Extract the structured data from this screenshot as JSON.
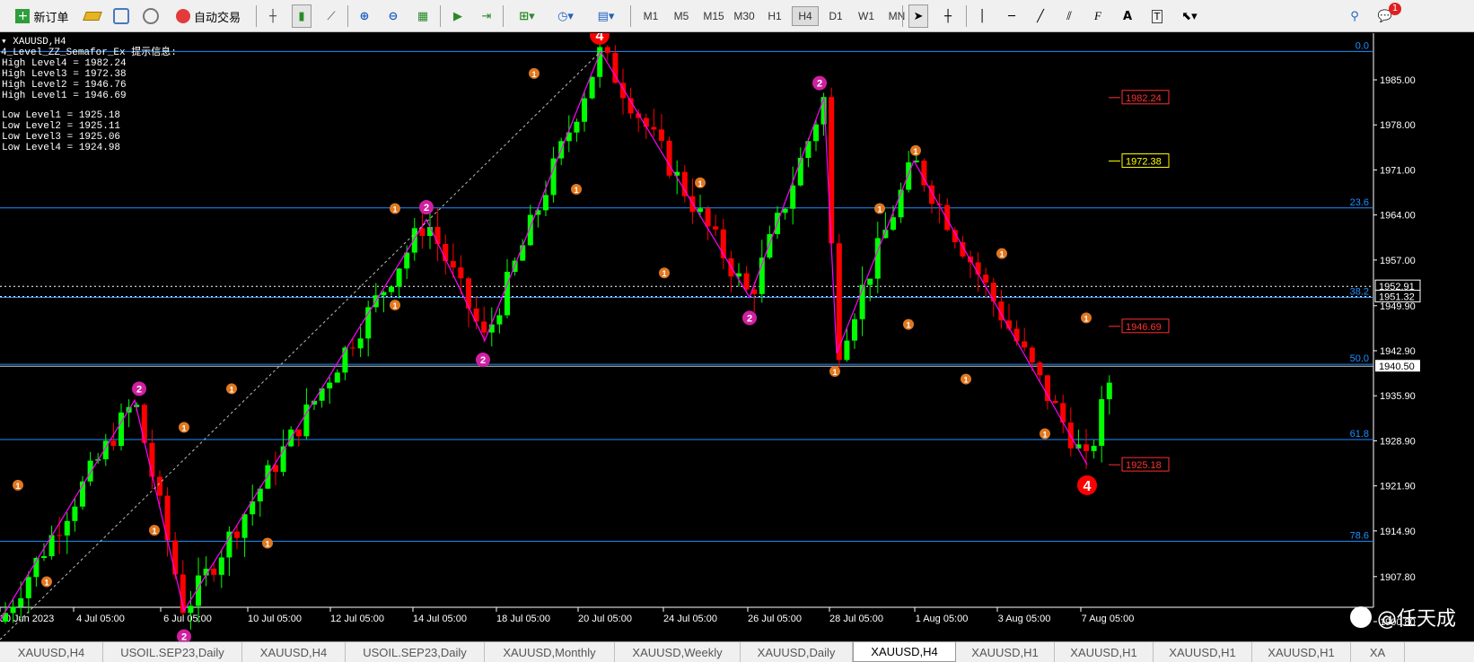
{
  "toolbar": {
    "new_order_label": "新订单",
    "autotrade_label": "自动交易",
    "timeframes": [
      "M1",
      "M5",
      "M15",
      "M30",
      "H1",
      "H4",
      "D1",
      "W1",
      "MN"
    ],
    "active_timeframe": "H4",
    "notification_count": "1"
  },
  "chart": {
    "symbol_label": "XAUUSD,H4",
    "indicator_title": "4_Level_ZZ_Semafor_Ex 提示信息:",
    "high_levels": [
      "High Level4 = 1982.24",
      "High Level3 = 1972.38",
      "High Level2 = 1946.76",
      "High Level1 = 1946.69"
    ],
    "low_levels": [
      "Low Level1 = 1925.18",
      "Low Level2 = 1925.11",
      "Low Level3 = 1925.06",
      "Low Level4 = 1924.98"
    ],
    "price_axis": [
      "1985.00",
      "1978.00",
      "1971.00",
      "1964.00",
      "1957.00",
      "1949.90",
      "1942.90",
      "1935.90",
      "1928.90",
      "1921.90",
      "1914.90",
      "1907.80",
      "1900.80"
    ],
    "price_axis_values": [
      1985.0,
      1978.0,
      1971.0,
      1964.0,
      1957.0,
      1949.9,
      1942.9,
      1935.9,
      1928.9,
      1921.9,
      1914.9,
      1907.8,
      1900.8
    ],
    "current_price": "1940.50",
    "marker_prices": [
      "1952.91",
      "1951.32"
    ],
    "fib_levels": [
      {
        "label": "0.0",
        "price": 1989.4
      },
      {
        "label": "23.6",
        "price": 1965.1
      },
      {
        "label": "38.2",
        "price": 1951.2
      },
      {
        "label": "50.0",
        "price": 1940.8
      },
      {
        "label": "61.8",
        "price": 1929.1
      },
      {
        "label": "78.6",
        "price": 1913.3
      }
    ],
    "level_boxes": [
      {
        "text": "1982.24",
        "color": "#ff3030",
        "price": 1982.24
      },
      {
        "text": "1972.38",
        "color": "#ffff00",
        "price": 1972.38
      },
      {
        "text": "1946.69",
        "color": "#ff3030",
        "price": 1946.69
      },
      {
        "text": "1925.18",
        "color": "#ff3030",
        "price": 1925.18
      }
    ],
    "date_axis": [
      "30 Jun 2023",
      "4 Jul 05:00",
      "6 Jul 05:00",
      "10 Jul 05:00",
      "12 Jul 05:00",
      "14 Jul 05:00",
      "18 Jul 05:00",
      "20 Jul 05:00",
      "24 Jul 05:00",
      "26 Jul 05:00",
      "28 Jul 05:00",
      "1 Aug 05:00",
      "3 Aug 05:00",
      "7 Aug 05:00"
    ],
    "semafor_labels": {
      "level1": "1",
      "level2": "2",
      "level4": "4"
    },
    "colors": {
      "bull": "#00ff00",
      "bear": "#ff0000",
      "zigzag": "#ff00ff",
      "fib": "#1e90ff",
      "level1": "#e07820",
      "level2": "#d020a0",
      "level4": "#ff0000"
    }
  },
  "tabs": [
    "XAUUSD,H4",
    "USOIL.SEP23,Daily",
    "XAUUSD,H4",
    "USOIL.SEP23,Daily",
    "XAUUSD,Monthly",
    "XAUUSD,Weekly",
    "XAUUSD,Daily",
    "XAUUSD,H4",
    "XAUUSD,H1",
    "XAUUSD,H1",
    "XAUUSD,H1",
    "XAUUSD,H1",
    "XA"
  ],
  "active_tab_index": 7,
  "watermark": "@任天成"
}
